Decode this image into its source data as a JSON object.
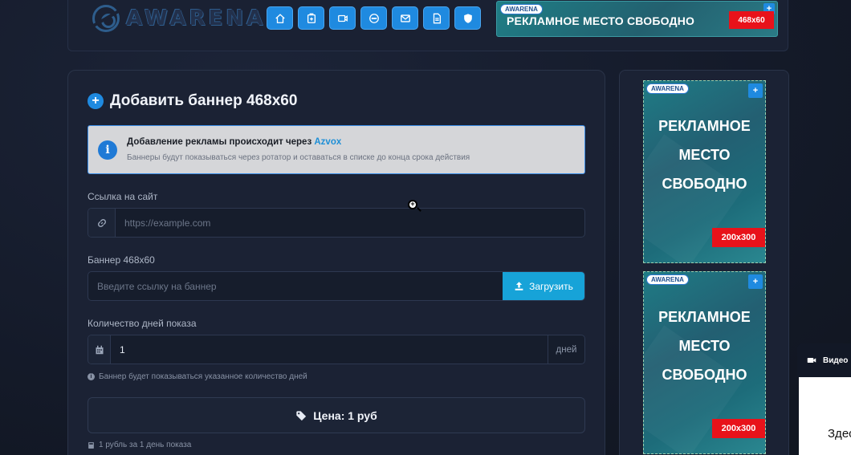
{
  "header": {
    "logo_text": "AWARENA",
    "nav": [
      {
        "icon": "home-icon"
      },
      {
        "icon": "add-file-icon"
      },
      {
        "icon": "video-icon"
      },
      {
        "icon": "chat-icon"
      },
      {
        "icon": "mail-icon"
      },
      {
        "icon": "document-icon"
      },
      {
        "icon": "shield-icon"
      }
    ],
    "ad": {
      "badge": "AWARENA",
      "plus": "+",
      "text": "РЕКЛАМНОЕ  МЕСТО СВОБОДНО",
      "size": "468x60"
    }
  },
  "form": {
    "title": "Добавить баннер 468x60",
    "info": {
      "title_prefix": "Добавление рекламы происходит через",
      "title_link": "Azvox",
      "subtitle": "Баннеры будут показываться через ротатор и оставаться в списке до конца срока действия"
    },
    "site_link": {
      "label": "Ссылка на сайт",
      "placeholder": "https://example.com",
      "value": ""
    },
    "banner": {
      "label": "Баннер 468x60",
      "placeholder": "Введите ссылку на баннер",
      "value": "",
      "upload_label": "Загрузить"
    },
    "days": {
      "label": "Количество дней показа",
      "value": "1",
      "unit": "дней",
      "hint": "Баннер будет показываться указанное количество дней"
    },
    "price": {
      "text": "Цена: 1 руб",
      "hint": "1 рубль за 1 день показа"
    }
  },
  "sidebar": {
    "ads": [
      {
        "badge": "AWARENA",
        "plus": "+",
        "line1": "РЕКЛАМНОЕ",
        "line2": "МЕСТО",
        "line3": "СВОБОДНО",
        "size": "200x300"
      },
      {
        "badge": "AWARENA",
        "plus": "+",
        "line1": "РЕКЛАМНОЕ",
        "line2": "МЕСТО",
        "line3": "СВОБОДНО",
        "size": "200x300"
      }
    ]
  },
  "widget": {
    "video_label": "Видео",
    "panel_text": "Здес"
  },
  "colors": {
    "accent": "#1f8ae0",
    "upload": "#17a3d8",
    "ad_size_bg": "#e8121a",
    "background": "#141a29"
  }
}
